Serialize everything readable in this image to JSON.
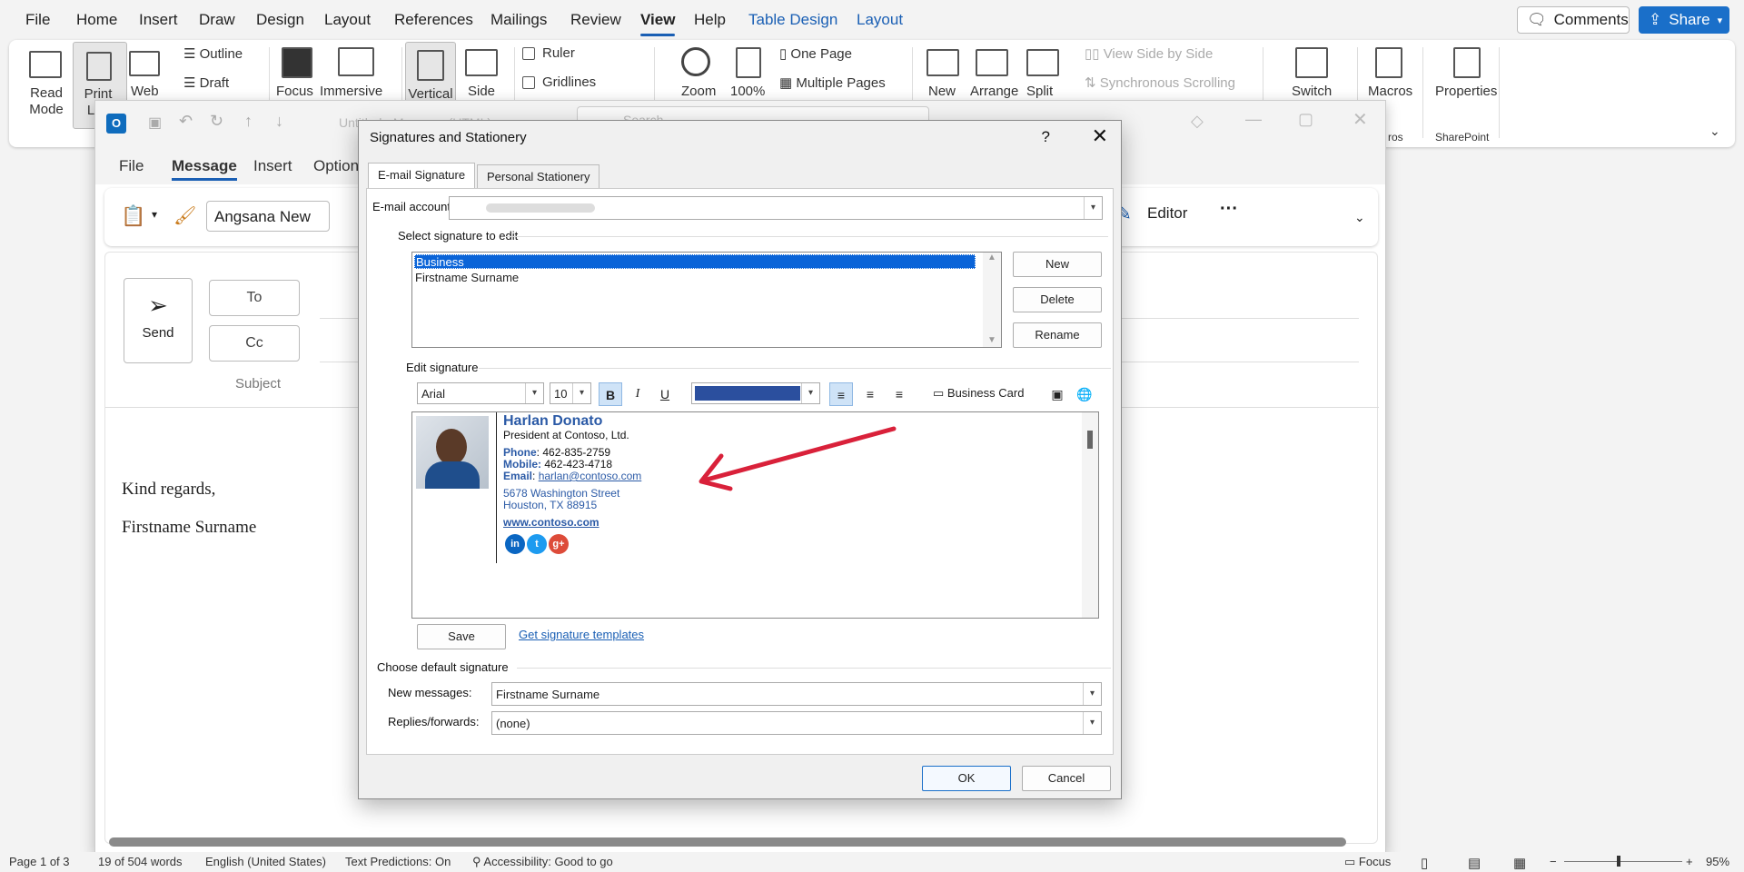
{
  "word_menu": {
    "items": [
      "File",
      "Home",
      "Insert",
      "Draw",
      "Design",
      "Layout",
      "References",
      "Mailings",
      "Review",
      "View",
      "Help",
      "Table Design",
      "Layout"
    ],
    "active": "View",
    "comments_label": "Comments",
    "share_label": "Share"
  },
  "ribbon": {
    "read_mode": [
      "Read",
      "Mode"
    ],
    "print_layout": [
      "Print",
      "Lay"
    ],
    "web": "Web",
    "outline": "Outline",
    "draft": "Draft",
    "focus": "Focus",
    "immersive": "Immersive",
    "vertical": "Vertical",
    "side": "Side",
    "ruler": "Ruler",
    "gridlines": "Gridlines",
    "zoom": "Zoom",
    "zoom_100": "100%",
    "one_page": "One Page",
    "multiple_pages": "Multiple Pages",
    "new": "New",
    "arrange": "Arrange",
    "split": "Split",
    "view_side_by_side": "View Side by Side",
    "synchronous_scrolling": "Synchronous Scrolling",
    "switch": "Switch",
    "macros": "Macros",
    "macros_group": "ros",
    "properties": "Properties",
    "sharepoint": "SharePoint"
  },
  "outlook": {
    "title": "Untitled - Message (HTML)",
    "search": "Search",
    "tabs": [
      "File",
      "Message",
      "Insert",
      "Option"
    ],
    "active_tab": "Message",
    "font_name": "Angsana New",
    "editor_label": "Editor",
    "send": "Send",
    "to": "To",
    "cc": "Cc",
    "subject": "Subject",
    "body_lines": [
      "Kind regards,",
      "Firstname Surname"
    ]
  },
  "dialog": {
    "title": "Signatures and Stationery",
    "help": "?",
    "tabs": [
      "E-mail Signature",
      "Personal Stationery"
    ],
    "email_account_label": "E-mail account:",
    "email_account_value": "",
    "select_label": "Select signature to edit",
    "signatures": [
      "Business",
      "Firstname Surname"
    ],
    "selected_signature": "Business",
    "buttons": {
      "new": "New",
      "delete": "Delete",
      "rename": "Rename",
      "save": "Save",
      "ok": "OK",
      "cancel": "Cancel"
    },
    "edit_label": "Edit signature",
    "font": "Arial",
    "size": "10",
    "bold": "B",
    "italic": "I",
    "underline": "U",
    "text_color": "#2b4f9e",
    "business_card": "Business Card",
    "templates_link": "Get signature templates",
    "default_label": "Choose default signature",
    "new_messages_label": "New messages:",
    "new_messages_value": "Firstname Surname",
    "replies_label": "Replies/forwards:",
    "replies_value": "(none)"
  },
  "signature": {
    "name": "Harlan Donato",
    "title": "President at Contoso, Ltd.",
    "phone_label": "Phone",
    "phone": "462-835-2759",
    "mobile_label": "Mobile:",
    "mobile": "462-423-4718",
    "email_label": "Email",
    "email": "harlan@contoso.com",
    "address1": "5678 Washington Street",
    "address2": "Houston, TX 88915",
    "website": "www.contoso.com",
    "social": [
      "in",
      "t",
      "g+"
    ]
  },
  "status_bar": {
    "page": "Page 1 of 3",
    "words": "19 of 504 words",
    "language": "English (United States)",
    "predictions": "Text Predictions: On",
    "accessibility": "Accessibility: Good to go",
    "focus": "Focus",
    "zoom": "95%"
  },
  "colors": {
    "accent": "#1a5fb4",
    "share": "#1a6fc9",
    "selection": "#0a64d8",
    "arrow": "#d9213a"
  }
}
